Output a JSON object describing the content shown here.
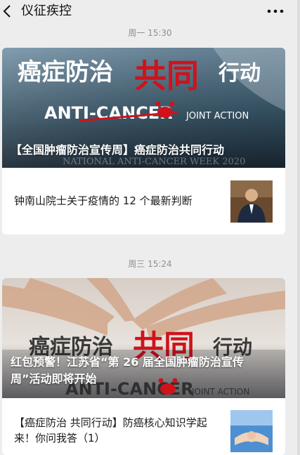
{
  "header": {
    "back_icon": "back-arrow-icon",
    "title": "仪征疾控",
    "more_icon": "more-dots-icon"
  },
  "colors": {
    "background": "#ededed",
    "card": "#ffffff",
    "accent_red": "#d0121b",
    "timestamp": "#8f8f8f"
  },
  "groups": [
    {
      "timestamp": "周一 15:30",
      "cover": {
        "graphic_text": {
          "slogan_left": "癌症防治",
          "slogan_red": "共同",
          "slogan_right": "行动",
          "anti": "ANTI-CANCER",
          "joint": "JOINT ACTION",
          "week": "NATIONAL ANTI-CANCER WEEK 2020"
        },
        "title": "【全国肿瘤防治宣传周】癌症防治共同行动"
      },
      "sub_article": {
        "title": "钟南山院士关于疫情的 12 个最新判断",
        "thumb_icon": "portrait-thumbnail"
      }
    },
    {
      "timestamp": "周三 15:24",
      "cover": {
        "graphic_text": {
          "slogan_left": "癌症防治",
          "slogan_red": "共同",
          "slogan_right": "行动",
          "anti": "ANTI-CANCER",
          "joint": "JOINT ACTION"
        },
        "title_line1": "红包预警！江苏省“第 26 届全国肿瘤防治宣传",
        "title_line2": "周”活动即将开始"
      },
      "sub_article": {
        "title_line1": "【癌症防治 共同行动】防癌核心知识学起",
        "title_line2": "来！你问我答（1）",
        "thumb_icon": "hands-thumbnail"
      }
    }
  ]
}
